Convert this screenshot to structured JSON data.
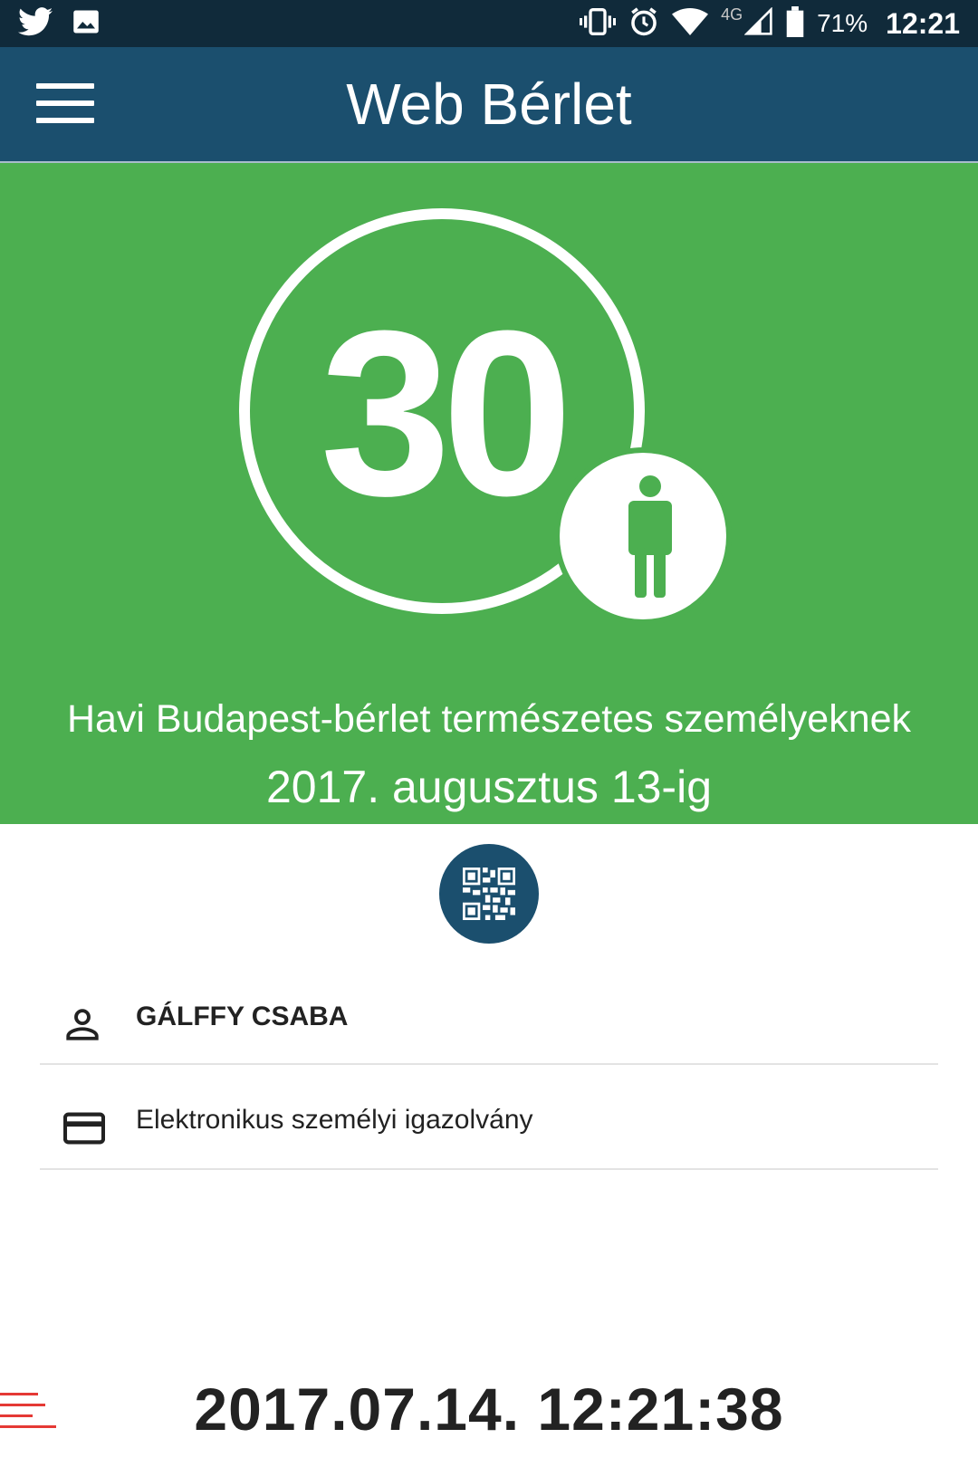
{
  "status_bar": {
    "battery": "71%",
    "time": "12:21",
    "network": "4G",
    "left_icons": [
      "twitter-icon",
      "image-icon"
    ],
    "right_icons": [
      "vibrate-icon",
      "alarm-icon",
      "wifi-icon",
      "signal-icon",
      "battery-icon"
    ]
  },
  "app_bar": {
    "title": "Web Bérlet",
    "menu_icon": "hamburger-menu-icon"
  },
  "ticket": {
    "days": "30",
    "type_icon": "person-icon",
    "name": "Havi Budapest-bérlet természetes személyeknek",
    "valid_until": "2017. augusztus 13-ig",
    "banner_color": "#4caf50"
  },
  "qr_button": {
    "icon": "qr-code-icon",
    "color": "#1b4f6e"
  },
  "holder": {
    "name": "GÁLFFY CSABA",
    "name_icon": "person-outline-icon",
    "document": "Elektronikus személyi igazolvány",
    "document_icon": "credit-card-icon"
  },
  "clock": {
    "datetime": "2017.07.14. 12:21:38",
    "accent_color": "#e53935"
  }
}
